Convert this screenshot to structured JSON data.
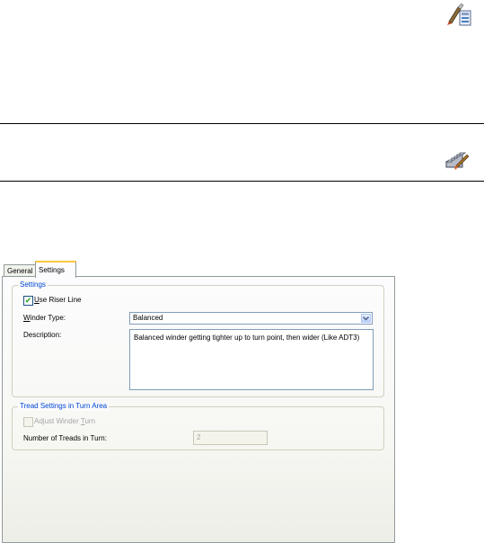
{
  "top_icons": {
    "icon1": "style-brush-icon",
    "icon2": "stair-paint-icon"
  },
  "dialog": {
    "tabs": [
      {
        "label": "General"
      },
      {
        "label": "Settings"
      }
    ],
    "settings_group": {
      "legend": "Settings",
      "use_riser_line": {
        "label": "Use Riser Line",
        "checked": true
      },
      "winder_type": {
        "label": "Winder Type:",
        "value": "Balanced"
      },
      "description": {
        "label": "Description:",
        "value": "Balanced winder getting tighter up to turn point, then wider (Like ADT3)"
      }
    },
    "tread_group": {
      "legend": "Tread Settings in Turn Area",
      "adjust_winder_turn": {
        "label": "Adjust Winder Turn",
        "checked": false
      },
      "number_of_treads": {
        "label": "Number of Treads in Turn:",
        "value": "2"
      }
    }
  },
  "colors": {
    "legend": "#0046d5",
    "tab_highlight": "#ffc83c",
    "check": "#21a121"
  }
}
